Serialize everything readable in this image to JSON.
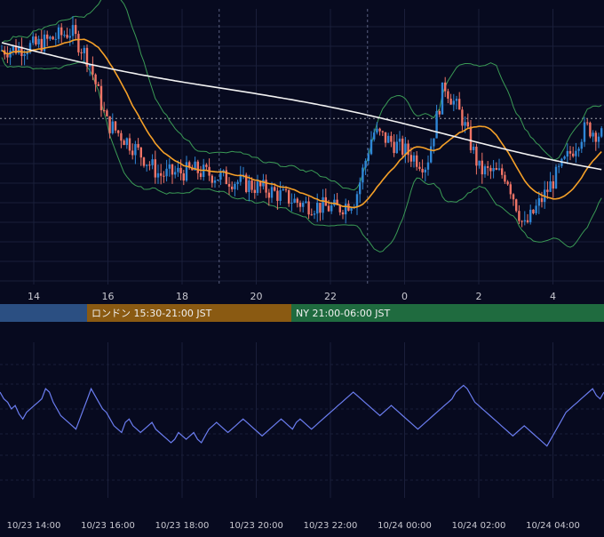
{
  "chart_data": {
    "type": "candlestick",
    "colors": {
      "background": "#070a1f",
      "grid": "#1a1f3a",
      "up_candle": "#2f86d6",
      "down_candle": "#f07466",
      "sma_long": "#f2f2f2",
      "sma_short": "#f5a028",
      "bollinger": "#3a9a55",
      "oscillator": "#6b7df0",
      "axis_text": "#c8c8d0"
    },
    "price_panel": {
      "y_range": [
        0,
        100
      ],
      "x_ticks": [
        "14",
        "16",
        "18",
        "20",
        "22",
        "0",
        "2",
        "4"
      ],
      "session_dividers_x_hours": [
        19.0,
        23.0
      ],
      "dotted_level": 58
    },
    "sessions": [
      {
        "label": "",
        "color": "#2b4f82"
      },
      {
        "label": "ロンドン 15:30-21:00 JST",
        "color": "#8a5a12"
      },
      {
        "label": "NY 21:00-06:00 JST",
        "color": "#1f6b3f"
      }
    ],
    "oscillator_panel": {
      "x_ticks": [
        "10/23 14:00",
        "10/23 16:00",
        "10/23 18:00",
        "10/23 20:00",
        "10/23 22:00",
        "10/24 00:00",
        "10/24 02:00",
        "10/24 04:00"
      ],
      "y_range": [
        0,
        100
      ],
      "values": [
        68,
        64,
        62,
        58,
        60,
        55,
        52,
        56,
        58,
        60,
        62,
        64,
        70,
        68,
        62,
        58,
        54,
        52,
        50,
        48,
        46,
        52,
        58,
        64,
        70,
        66,
        62,
        58,
        56,
        52,
        48,
        46,
        44,
        50,
        52,
        48,
        46,
        44,
        46,
        48,
        50,
        46,
        44,
        42,
        40,
        38,
        40,
        44,
        42,
        40,
        42,
        44,
        40,
        38,
        42,
        46,
        48,
        50,
        48,
        46,
        44,
        46,
        48,
        50,
        52,
        50,
        48,
        46,
        44,
        42,
        44,
        46,
        48,
        50,
        52,
        50,
        48,
        46,
        50,
        52,
        50,
        48,
        46,
        48,
        50,
        52,
        54,
        56,
        58,
        60,
        62,
        64,
        66,
        68,
        66,
        64,
        62,
        60,
        58,
        56,
        54,
        56,
        58,
        60,
        58,
        56,
        54,
        52,
        50,
        48,
        46,
        48,
        50,
        52,
        54,
        56,
        58,
        60,
        62,
        64,
        68,
        70,
        72,
        70,
        66,
        62,
        60,
        58,
        56,
        54,
        52,
        50,
        48,
        46,
        44,
        42,
        44,
        46,
        48,
        46,
        44,
        42,
        40,
        38,
        36,
        40,
        44,
        48,
        52,
        56,
        58,
        60,
        62,
        64,
        66,
        68,
        70,
        66,
        64,
        68
      ]
    }
  }
}
